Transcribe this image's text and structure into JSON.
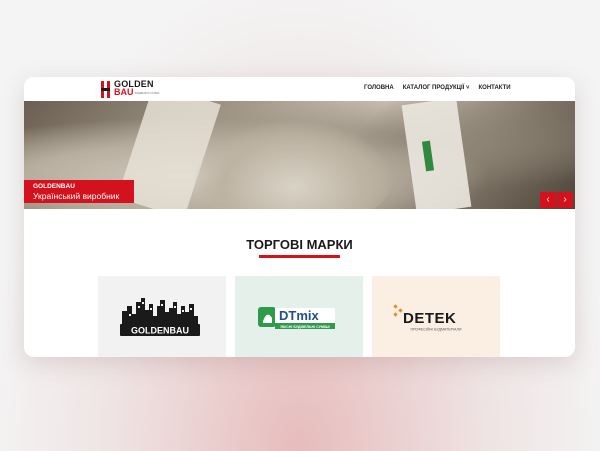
{
  "header": {
    "logo": {
      "line1": "GOLDEN",
      "line2": "BAU",
      "tagline": "БУДІВЕЛЬНІ СУМІШІ"
    },
    "nav": [
      {
        "label": "ГОЛОВНА"
      },
      {
        "label": "КАТАЛОГ ПРОДУКЦІЇ ˅"
      },
      {
        "label": "КОНТАКТИ"
      }
    ]
  },
  "hero": {
    "brand": "GOLDENBAU",
    "subtitle": "Український виробник",
    "prev_icon": "chevron-left-icon",
    "next_icon": "chevron-right-icon",
    "prev_label": "‹",
    "next_label": "›"
  },
  "brands_section": {
    "title": "ТОРГОВІ МАРКИ",
    "brands": [
      {
        "name": "GOLDENBAU"
      },
      {
        "name": "DTmix",
        "tagline": "ЯКІСНІ БУДІВЕЛЬНІ СУМІШІ"
      },
      {
        "name": "DETEK",
        "tagline": "ПРОФЕСІЙНІ БУДМАТЕРІАЛИ"
      }
    ]
  },
  "colors": {
    "accent": "#d4121e",
    "dark": "#1a1a1a",
    "dtmix_green": "#2e9a4a",
    "dtmix_blue": "#1f4f8f",
    "detek_orange": "#e88a1a"
  }
}
